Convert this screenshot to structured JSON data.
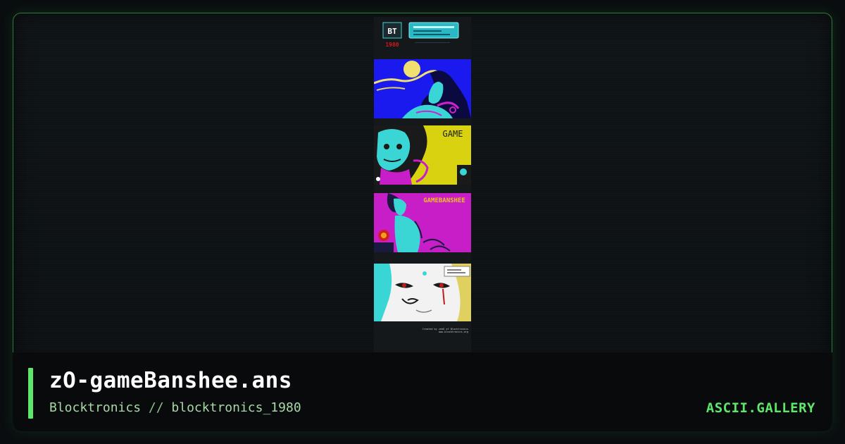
{
  "artwork": {
    "title": "zO-gameBanshee.ans",
    "group": "Blocktronics",
    "separator": "//",
    "pack": "blocktronics_1980",
    "header_logo_text": "BT",
    "header_year_text": "1980",
    "panel3_text": "GAME",
    "panel4_text": "GAMEBANSHEE",
    "footer_credit_line1": "Created by zeeO of Blocktronics",
    "footer_credit_line2": "www.blocktronics.org"
  },
  "site": {
    "brand": "ASCII.GALLERY"
  },
  "colors": {
    "accent": "#5ee86a",
    "frame_border": "#2e7a3a",
    "background": "#0a0d0f",
    "panel_blue": "#1a1aef",
    "panel_yellow": "#d8d210",
    "panel_magenta": "#c81ec8",
    "panel_white": "#f2f2f2",
    "cyan": "#3ad6d6"
  }
}
